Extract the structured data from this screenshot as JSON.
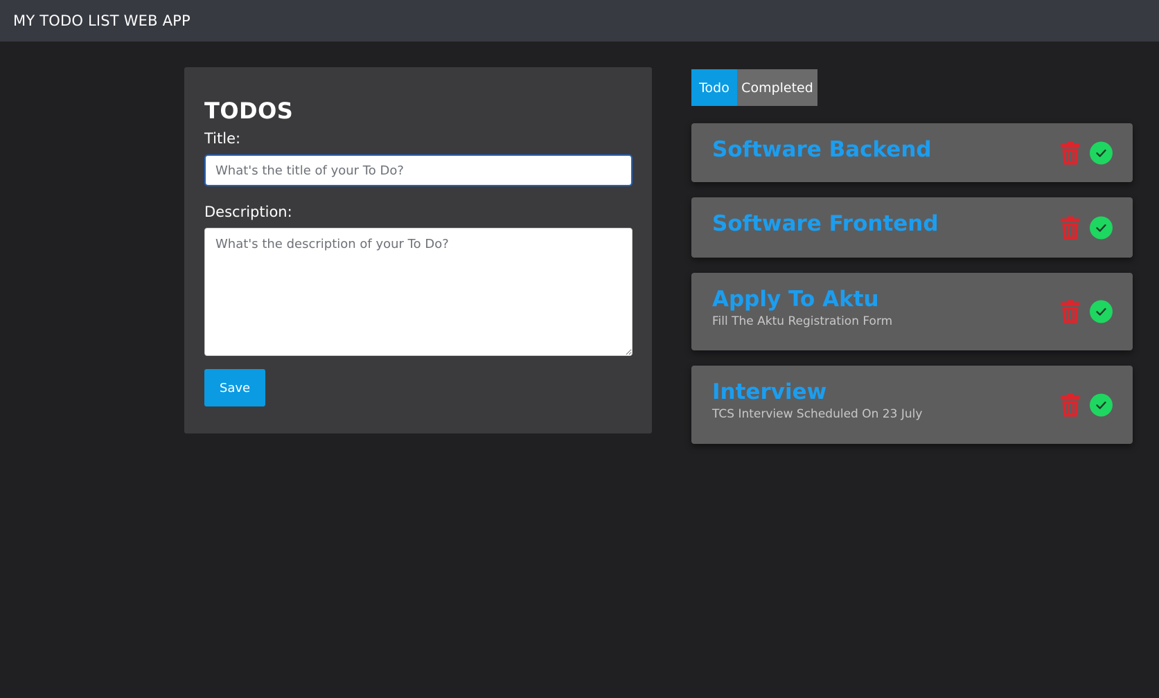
{
  "header": {
    "title": "MY TODO LIST WEB APP"
  },
  "form": {
    "heading": "TODOS",
    "title_label": "Title:",
    "title_placeholder": "What's the title of your To Do?",
    "title_value": "",
    "description_label": "Description:",
    "description_placeholder": "What's the description of your To Do?",
    "description_value": "",
    "save_label": "Save"
  },
  "tabs": [
    {
      "label": "Todo",
      "active": true
    },
    {
      "label": "Completed",
      "active": false
    }
  ],
  "todos": [
    {
      "title": "Software Backend",
      "description": ""
    },
    {
      "title": "Software Frontend",
      "description": ""
    },
    {
      "title": "Apply To Aktu",
      "description": "Fill The Aktu Registration Form"
    },
    {
      "title": "Interview",
      "description": "TCS Interview Scheduled On 23 July"
    }
  ],
  "icons": {
    "delete": "trash-icon",
    "complete": "check-circle-icon"
  },
  "colors": {
    "accent": "#0a9be3",
    "todo_title": "#1b9ef0",
    "delete": "#e0242b",
    "complete": "#1ed760",
    "background": "#202022",
    "header": "#373a41",
    "card": "#5d5d5e"
  }
}
